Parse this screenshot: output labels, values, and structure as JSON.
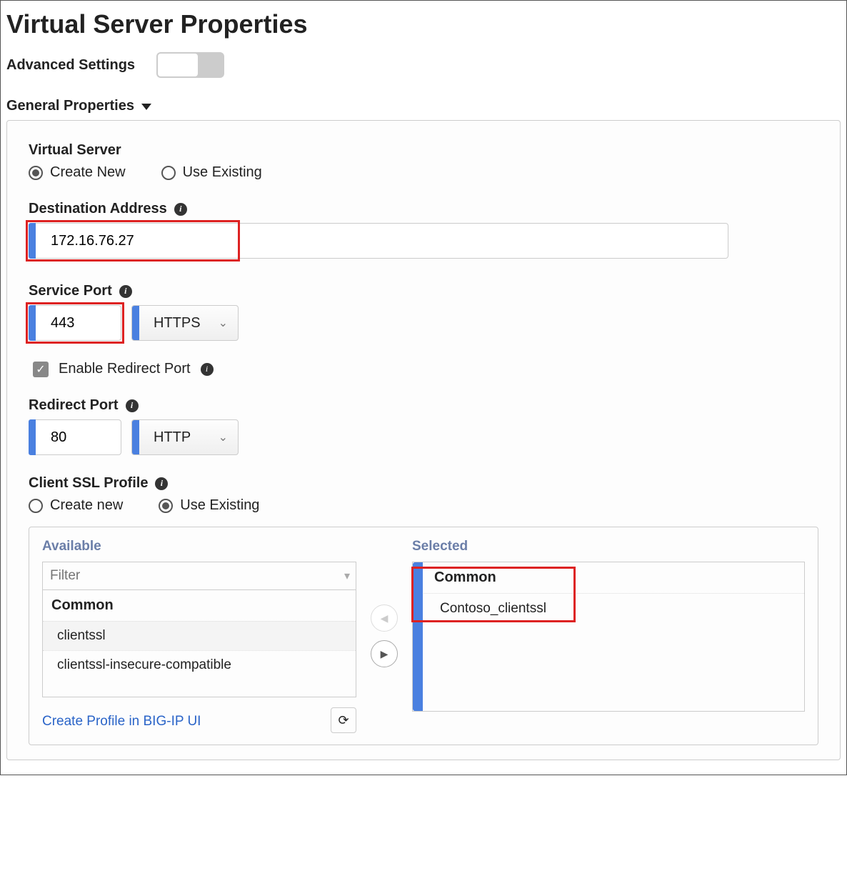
{
  "title": "Virtual Server Properties",
  "advanced_label": "Advanced Settings",
  "section_general": "General Properties",
  "virtual_server": {
    "label": "Virtual Server",
    "opt_create": "Create New",
    "opt_existing": "Use Existing"
  },
  "dest_addr": {
    "label": "Destination Address",
    "value": "172.16.76.27"
  },
  "service_port": {
    "label": "Service Port",
    "value": "443",
    "proto": "HTTPS"
  },
  "enable_redirect": "Enable Redirect Port",
  "redirect_port": {
    "label": "Redirect Port",
    "value": "80",
    "proto": "HTTP"
  },
  "ssl_profile": {
    "label": "Client SSL Profile",
    "opt_create": "Create new",
    "opt_existing": "Use Existing",
    "available_label": "Available",
    "selected_label": "Selected",
    "filter_placeholder": "Filter",
    "group": "Common",
    "available_items": [
      "clientssl",
      "clientssl-insecure-compatible"
    ],
    "selected_items": [
      "Contoso_clientssl"
    ],
    "create_link": "Create Profile in BIG-IP UI"
  }
}
